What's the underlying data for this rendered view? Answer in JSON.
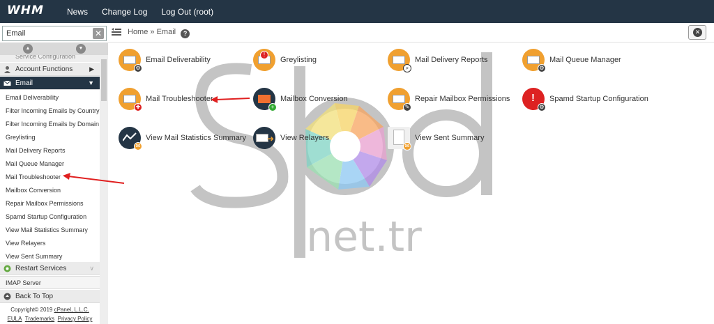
{
  "topbar": {
    "logo": "WHM",
    "nav": [
      "News",
      "Change Log",
      "Log Out (root)"
    ]
  },
  "sidebar": {
    "search_value": "Email",
    "clear_label": "✕",
    "truncated_category": "Service Configuration",
    "categories": {
      "account_functions": "Account Functions",
      "email": "Email",
      "restart_services": "Restart Services",
      "back_to_top": "Back To Top"
    },
    "email_items": [
      "Email Deliverability",
      "Filter Incoming Emails by Country",
      "Filter Incoming Emails by Domain",
      "Greylisting",
      "Mail Delivery Reports",
      "Mail Queue Manager",
      "Mail Troubleshooter",
      "Mailbox Conversion",
      "Repair Mailbox Permissions",
      "Spamd Startup Configuration",
      "View Mail Statistics Summary",
      "View Relayers",
      "View Sent Summary"
    ],
    "restart_item": "IMAP Server",
    "footer": {
      "copyright_prefix": "Copyright© 2019 ",
      "company": "cPanel, L.L.C.",
      "links": [
        "EULA",
        "Trademarks",
        "Privacy Policy"
      ]
    }
  },
  "breadcrumb": {
    "home": "Home",
    "separator": "»",
    "current": "Email",
    "help": "?"
  },
  "tiles": [
    {
      "label": "Email Deliverability",
      "icon": "email-deliverability-icon",
      "color": "#f0a030"
    },
    {
      "label": "Greylisting",
      "icon": "greylisting-icon",
      "color": "#f0a030"
    },
    {
      "label": "Mail Delivery Reports",
      "icon": "mail-delivery-reports-icon",
      "color": "#f0a030"
    },
    {
      "label": "Mail Queue Manager",
      "icon": "mail-queue-manager-icon",
      "color": "#f0a030"
    },
    {
      "label": "Mail Troubleshooter",
      "icon": "mail-troubleshooter-icon",
      "color": "#f0a030"
    },
    {
      "label": "Mailbox Conversion",
      "icon": "mailbox-conversion-icon",
      "color": "#f07030"
    },
    {
      "label": "Repair Mailbox Permissions",
      "icon": "repair-mailbox-permissions-icon",
      "color": "#f0a030"
    },
    {
      "label": "Spamd Startup Configuration",
      "icon": "spamd-startup-configuration-icon",
      "color": "#d22"
    },
    {
      "label": "View Mail Statistics Summary",
      "icon": "view-mail-statistics-summary-icon",
      "color": "#243545"
    },
    {
      "label": "View Relayers",
      "icon": "view-relayers-icon",
      "color": "#243545"
    },
    {
      "label": "View Sent Summary",
      "icon": "view-sent-summary-icon",
      "color": "#f0f0f0"
    }
  ],
  "watermark": {
    "line1": "spd",
    "line2": ".net.tr"
  },
  "colors": {
    "topbar": "#243545",
    "accent": "#f0a030",
    "annotation_arrow": "#e02020"
  }
}
